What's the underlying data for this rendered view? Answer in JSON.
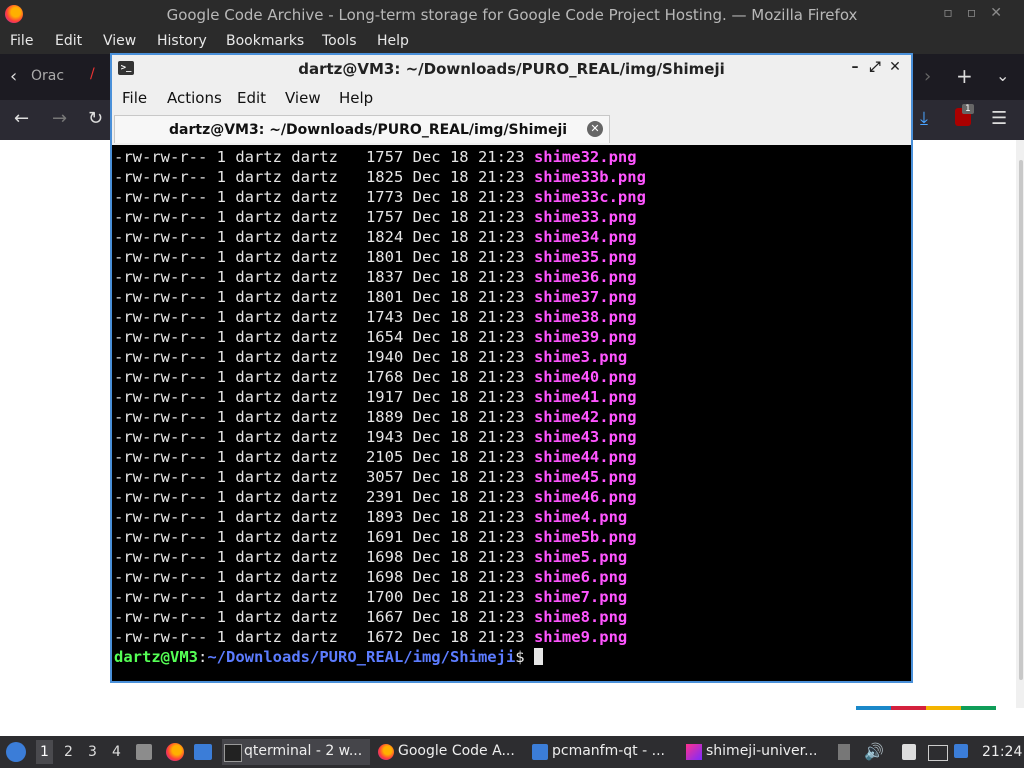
{
  "firefox": {
    "title": "Google Code Archive - Long-term storage for Google Code Project Hosting. — Mozilla Firefox",
    "menu": [
      "File",
      "Edit",
      "View",
      "History",
      "Bookmarks",
      "Tools",
      "Help"
    ],
    "tab_partial": "Orac",
    "badge": "1"
  },
  "terminal": {
    "title": "dartz@VM3: ~/Downloads/PURO_REAL/img/Shimeji",
    "menu": [
      "File",
      "Actions",
      "Edit",
      "View",
      "Help"
    ],
    "tab_label": "dartz@VM3: ~/Downloads/PURO_REAL/img/Shimeji",
    "rows": [
      {
        "perm": "-rw-rw-r--",
        "links": "1",
        "user": "dartz",
        "group": "dartz",
        "size": "1757",
        "month": "Dec",
        "day": "18",
        "time": "21:23",
        "name": "shime32.png"
      },
      {
        "perm": "-rw-rw-r--",
        "links": "1",
        "user": "dartz",
        "group": "dartz",
        "size": "1825",
        "month": "Dec",
        "day": "18",
        "time": "21:23",
        "name": "shime33b.png"
      },
      {
        "perm": "-rw-rw-r--",
        "links": "1",
        "user": "dartz",
        "group": "dartz",
        "size": "1773",
        "month": "Dec",
        "day": "18",
        "time": "21:23",
        "name": "shime33c.png"
      },
      {
        "perm": "-rw-rw-r--",
        "links": "1",
        "user": "dartz",
        "group": "dartz",
        "size": "1757",
        "month": "Dec",
        "day": "18",
        "time": "21:23",
        "name": "shime33.png"
      },
      {
        "perm": "-rw-rw-r--",
        "links": "1",
        "user": "dartz",
        "group": "dartz",
        "size": "1824",
        "month": "Dec",
        "day": "18",
        "time": "21:23",
        "name": "shime34.png"
      },
      {
        "perm": "-rw-rw-r--",
        "links": "1",
        "user": "dartz",
        "group": "dartz",
        "size": "1801",
        "month": "Dec",
        "day": "18",
        "time": "21:23",
        "name": "shime35.png"
      },
      {
        "perm": "-rw-rw-r--",
        "links": "1",
        "user": "dartz",
        "group": "dartz",
        "size": "1837",
        "month": "Dec",
        "day": "18",
        "time": "21:23",
        "name": "shime36.png"
      },
      {
        "perm": "-rw-rw-r--",
        "links": "1",
        "user": "dartz",
        "group": "dartz",
        "size": "1801",
        "month": "Dec",
        "day": "18",
        "time": "21:23",
        "name": "shime37.png"
      },
      {
        "perm": "-rw-rw-r--",
        "links": "1",
        "user": "dartz",
        "group": "dartz",
        "size": "1743",
        "month": "Dec",
        "day": "18",
        "time": "21:23",
        "name": "shime38.png"
      },
      {
        "perm": "-rw-rw-r--",
        "links": "1",
        "user": "dartz",
        "group": "dartz",
        "size": "1654",
        "month": "Dec",
        "day": "18",
        "time": "21:23",
        "name": "shime39.png"
      },
      {
        "perm": "-rw-rw-r--",
        "links": "1",
        "user": "dartz",
        "group": "dartz",
        "size": "1940",
        "month": "Dec",
        "day": "18",
        "time": "21:23",
        "name": "shime3.png"
      },
      {
        "perm": "-rw-rw-r--",
        "links": "1",
        "user": "dartz",
        "group": "dartz",
        "size": "1768",
        "month": "Dec",
        "day": "18",
        "time": "21:23",
        "name": "shime40.png"
      },
      {
        "perm": "-rw-rw-r--",
        "links": "1",
        "user": "dartz",
        "group": "dartz",
        "size": "1917",
        "month": "Dec",
        "day": "18",
        "time": "21:23",
        "name": "shime41.png"
      },
      {
        "perm": "-rw-rw-r--",
        "links": "1",
        "user": "dartz",
        "group": "dartz",
        "size": "1889",
        "month": "Dec",
        "day": "18",
        "time": "21:23",
        "name": "shime42.png"
      },
      {
        "perm": "-rw-rw-r--",
        "links": "1",
        "user": "dartz",
        "group": "dartz",
        "size": "1943",
        "month": "Dec",
        "day": "18",
        "time": "21:23",
        "name": "shime43.png"
      },
      {
        "perm": "-rw-rw-r--",
        "links": "1",
        "user": "dartz",
        "group": "dartz",
        "size": "2105",
        "month": "Dec",
        "day": "18",
        "time": "21:23",
        "name": "shime44.png"
      },
      {
        "perm": "-rw-rw-r--",
        "links": "1",
        "user": "dartz",
        "group": "dartz",
        "size": "3057",
        "month": "Dec",
        "day": "18",
        "time": "21:23",
        "name": "shime45.png"
      },
      {
        "perm": "-rw-rw-r--",
        "links": "1",
        "user": "dartz",
        "group": "dartz",
        "size": "2391",
        "month": "Dec",
        "day": "18",
        "time": "21:23",
        "name": "shime46.png"
      },
      {
        "perm": "-rw-rw-r--",
        "links": "1",
        "user": "dartz",
        "group": "dartz",
        "size": "1893",
        "month": "Dec",
        "day": "18",
        "time": "21:23",
        "name": "shime4.png"
      },
      {
        "perm": "-rw-rw-r--",
        "links": "1",
        "user": "dartz",
        "group": "dartz",
        "size": "1691",
        "month": "Dec",
        "day": "18",
        "time": "21:23",
        "name": "shime5b.png"
      },
      {
        "perm": "-rw-rw-r--",
        "links": "1",
        "user": "dartz",
        "group": "dartz",
        "size": "1698",
        "month": "Dec",
        "day": "18",
        "time": "21:23",
        "name": "shime5.png"
      },
      {
        "perm": "-rw-rw-r--",
        "links": "1",
        "user": "dartz",
        "group": "dartz",
        "size": "1698",
        "month": "Dec",
        "day": "18",
        "time": "21:23",
        "name": "shime6.png"
      },
      {
        "perm": "-rw-rw-r--",
        "links": "1",
        "user": "dartz",
        "group": "dartz",
        "size": "1700",
        "month": "Dec",
        "day": "18",
        "time": "21:23",
        "name": "shime7.png"
      },
      {
        "perm": "-rw-rw-r--",
        "links": "1",
        "user": "dartz",
        "group": "dartz",
        "size": "1667",
        "month": "Dec",
        "day": "18",
        "time": "21:23",
        "name": "shime8.png"
      },
      {
        "perm": "-rw-rw-r--",
        "links": "1",
        "user": "dartz",
        "group": "dartz",
        "size": "1672",
        "month": "Dec",
        "day": "18",
        "time": "21:23",
        "name": "shime9.png"
      }
    ],
    "prompt_user": "dartz@VM3",
    "prompt_sep": ":",
    "prompt_path": "~/Downloads/PURO_REAL/img/Shimeji",
    "prompt_symbol": "$"
  },
  "taskbar": {
    "workspaces": [
      "1",
      "2",
      "3",
      "4"
    ],
    "tasks": [
      {
        "label": "qterminal - 2 w...",
        "icon": "terminal-icon"
      },
      {
        "label": "Google Code A...",
        "icon": "firefox-icon"
      },
      {
        "label": "pcmanfm-qt - ...",
        "icon": "folder-icon"
      },
      {
        "label": "shimeji-univer...",
        "icon": "intellij-icon"
      }
    ],
    "clock": "21:24"
  },
  "colors": {
    "accent": "#4a90d9",
    "filename": "#ff55ff",
    "prompt_user": "#55ff55",
    "prompt_path": "#5c7cff"
  }
}
